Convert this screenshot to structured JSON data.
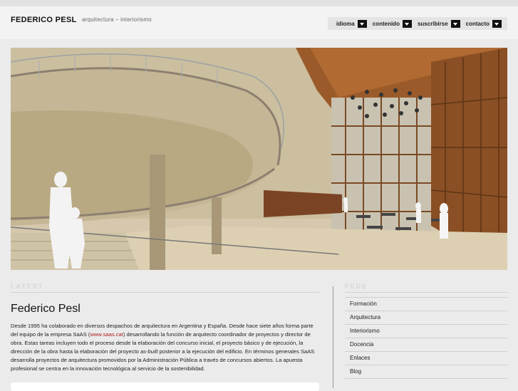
{
  "header": {
    "brand": "FEDERICO PESL",
    "tagline": "arquitectura – interiorismo",
    "nav": [
      {
        "label": "idioma"
      },
      {
        "label": "contenido"
      },
      {
        "label": "suscribirse"
      },
      {
        "label": "contacto"
      }
    ]
  },
  "latest": {
    "section_label": "LATEST",
    "title": "Federico Pesl",
    "body_1": "Desde 1995 ha colaborado en diversos despachos de arquitectura en Argentina y España. Desde hace siete años forma parte del equipo de la empresa SaAS (",
    "link": "www.saas.cat",
    "body_2": ") desarrollando la función de arquitecto coordinador de proyectos y director de obra. Estas tareas incluyen todo el proceso desde la elaboración del concurso inicial, el proyecto básico y de ejecución, la dirección de la obra hasta la elaboración del proyecto ",
    "emph": "as-built",
    "body_3": " posterior a la ejecución del edificio. En términos generales SaAS desarrolla proyectos de arquitectura promovidos por la Administración Pública a través de concursos abiertos. La apuesta profesional se centra en la innovación tecnológica al servicio de la sostenibilidad."
  },
  "sidebar": {
    "section_label": "FEDE",
    "items": [
      {
        "label": "Formación"
      },
      {
        "label": "Arquitectura"
      },
      {
        "label": "Interiorismo"
      },
      {
        "label": "Docencia"
      },
      {
        "label": "Enlaces"
      },
      {
        "label": "Blog"
      }
    ]
  },
  "colors": {
    "background": "#ebebeb",
    "link": "#b02020",
    "nav_arrow": "#111111"
  },
  "icons": {
    "nav_dropdown": "chevron-down-icon"
  }
}
